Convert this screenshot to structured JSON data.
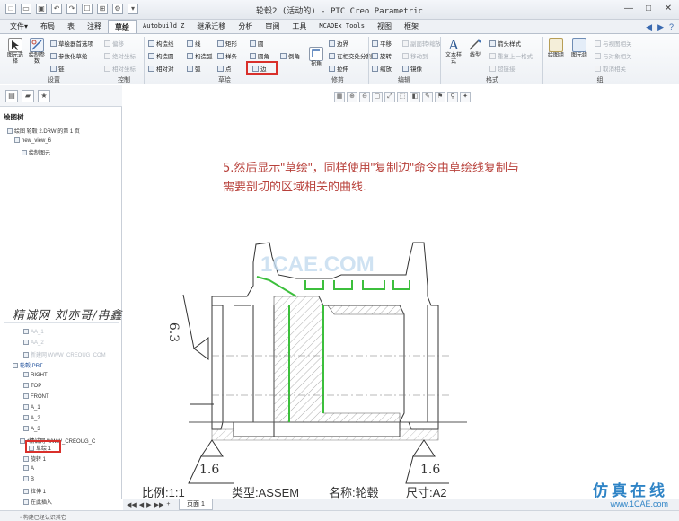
{
  "window": {
    "title": "轮毂2 (活动的) - PTC Creo Parametric",
    "controls": [
      "—",
      "□",
      "✕"
    ]
  },
  "quick_access": [
    "□",
    "▭",
    "▣",
    "↶",
    "↷",
    "☐",
    "⊞",
    "⚙",
    "▾"
  ],
  "menu": {
    "tabs": [
      "文件▾",
      "布局",
      "表",
      "注释",
      "草绘",
      "Autobuild Z",
      "继承迁移",
      "分析",
      "审阅",
      "工具",
      "MCADEx Tools",
      "视图",
      "框架"
    ],
    "right_icons": [
      "◀",
      "▶",
      "?"
    ]
  },
  "ribbon": {
    "settings": {
      "select_label": "图元选择",
      "draw_settings_label": "绘制参数",
      "sketch_prefs": "草绘器首选项",
      "param_sketch": "参数化草绘",
      "chain": "链"
    },
    "control": {
      "offset": "偏移",
      "relative_coords": "绝对坐标",
      "relative_coords2": "相对坐标"
    },
    "sketch": {
      "construct_line": "构造线",
      "line": "线",
      "rectangle": "矩形",
      "circle": "圆",
      "arc": "弧",
      "spline": "样条",
      "fillet": "圆角",
      "chamfer": "倒角",
      "point": "点",
      "construct_circle": "构造圆",
      "relative": "相对对",
      "rel2": "相对",
      "edge": "边",
      "construct_arc": "构造弧"
    },
    "trim": {
      "corner": "拐角",
      "boundary": "边界",
      "split_at_point": "在相交处分割",
      "stretch": "拉伸"
    },
    "edit": {
      "translate": "平移",
      "rotate": "旋转",
      "scale": "缩放",
      "mirror": "镜像",
      "translate_copy": "副面转/缩放",
      "move_to": "移动到",
      "grp": "组"
    },
    "format": {
      "text_style": "文本样式",
      "line_style": "线型",
      "arrow_style": "箭头样式",
      "repeat": "重复上一格式",
      "hatch": "超链接"
    },
    "group": {
      "group_label": "绘图组",
      "view_label": "图元组",
      "relate_view": "与视图相关",
      "relate_object": "与对象相关",
      "unrelate": "取消相关"
    },
    "group_labels": [
      "设置",
      "控制",
      "草绘",
      "修剪",
      "编辑",
      "格式",
      "组"
    ]
  },
  "navigator": {
    "drawing_tree_title": "绘图树",
    "items_top": [
      "绘图 轮毂 2.DRW 的第 1 页",
      "new_view_6",
      "绘制图元"
    ],
    "model_items": [
      "AA_1",
      "AA_2",
      "新建网 WWW_CREOUG_COM",
      "轮毂.PRT",
      "RIGHT",
      "TOP",
      "FRONT",
      "A_1",
      "A_2",
      "A_3",
      "*精诚网 WWW_CREOUG_C",
      "草绘 1",
      "旋转 1",
      "A",
      "B",
      "拉伸 1",
      "在此插入"
    ],
    "selected_item": "轮毂.PRT"
  },
  "overlay_text": "精诚网 刘亦哥/冉鑫",
  "graphics_toolbar": [
    "▦",
    "⊕",
    "⊖",
    "▢",
    "⤢",
    "⬚",
    "◧",
    "✎",
    "⚑",
    "⚲",
    "✦"
  ],
  "annotation": {
    "number": "5.",
    "line1": "然后显示\"草绘\"，同样使用\"复制边\"命令由草绘线复制与",
    "line2": "需要剖切的区域相关的曲线."
  },
  "drawing": {
    "roughness_left_value": "6.3",
    "roughness_bl_value": "1.6",
    "roughness_br_value": "1.6"
  },
  "title_block": {
    "scale_label": "比例:1:1",
    "type_label": "类型:ASSEM",
    "name_label": "名称:轮毂",
    "size_label": "尺寸:A2"
  },
  "page_tab": "页面 1",
  "page_nav": [
    "◀◀",
    "◀",
    "▶",
    "▶▶",
    "+"
  ],
  "status_text": "• 构建已经认识其它",
  "watermark": "1CAE.COM",
  "brand": {
    "cn": "仿真在线",
    "url": "www.1CAE.com"
  },
  "colors": {
    "sketch_green": "#3cbf3c",
    "highlight_red": "#d9302b",
    "annotation_red": "#b8413b",
    "brand_blue": "#2f84c6"
  }
}
